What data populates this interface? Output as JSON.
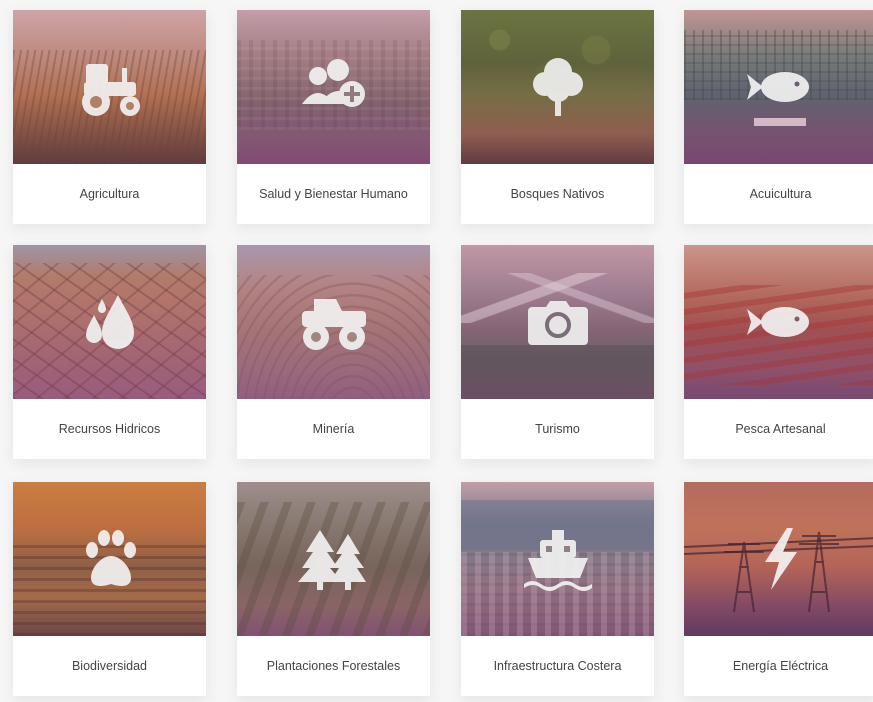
{
  "categories": [
    {
      "label": "Agricultura",
      "icon": "tractor-icon"
    },
    {
      "label": "Salud y Bienestar Humano",
      "icon": "users-plus-icon"
    },
    {
      "label": "Bosques Nativos",
      "icon": "tree-icon"
    },
    {
      "label": "Acuicultura",
      "icon": "fish-icon"
    },
    {
      "label": "Recursos Hidricos",
      "icon": "water-drops-icon"
    },
    {
      "label": "Minería",
      "icon": "mining-truck-icon"
    },
    {
      "label": "Turismo",
      "icon": "camera-icon"
    },
    {
      "label": "Pesca Artesanal",
      "icon": "fish-icon"
    },
    {
      "label": "Biodiversidad",
      "icon": "paw-icon"
    },
    {
      "label": "Plantaciones Forestales",
      "icon": "pine-trees-icon"
    },
    {
      "label": "Infraestructura Costera",
      "icon": "ship-icon"
    },
    {
      "label": "Energía Eléctrica",
      "icon": "lightning-icon"
    }
  ],
  "colors": {
    "page_background": "#f6f6f6",
    "card_background": "#ffffff",
    "label_text": "#444444",
    "icon_fill": "#f2f2f2"
  }
}
